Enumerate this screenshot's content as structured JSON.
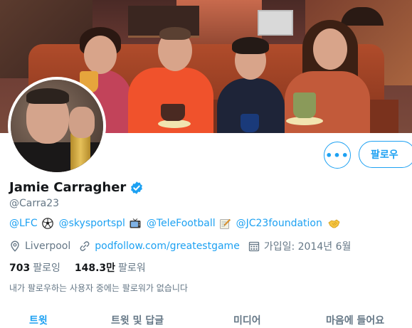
{
  "profile": {
    "display_name": "Jamie Carragher",
    "handle": "@Carra23",
    "verified": true
  },
  "actions": {
    "more_label": "•••",
    "follow_label": "팔로우"
  },
  "bio": {
    "mentions": [
      "@LFC",
      "@skysportspl",
      "@TeleFootball",
      "@JC23foundation"
    ],
    "emojis": [
      "soccer-ball",
      "television",
      "memo",
      "handshake"
    ]
  },
  "meta": {
    "location": "Liverpool",
    "website": "podfollow.com/greatestgame",
    "joined": "가입일: 2014년 6월"
  },
  "counts": {
    "following_value": "703",
    "following_label": "팔로잉",
    "followers_value": "148.3만",
    "followers_label": "팔로워"
  },
  "followers_you_know": "내가 팔로우하는 사용자 중에는 팔로워가 없습니다",
  "tabs": [
    {
      "label": "트윗",
      "active": true
    },
    {
      "label": "트윗 및 답글",
      "active": false
    },
    {
      "label": "미디어",
      "active": false
    },
    {
      "label": "마음에 들어요",
      "active": false
    }
  ],
  "colors": {
    "accent": "#1da1f2",
    "text_primary": "#14171a",
    "text_secondary": "#657786"
  }
}
